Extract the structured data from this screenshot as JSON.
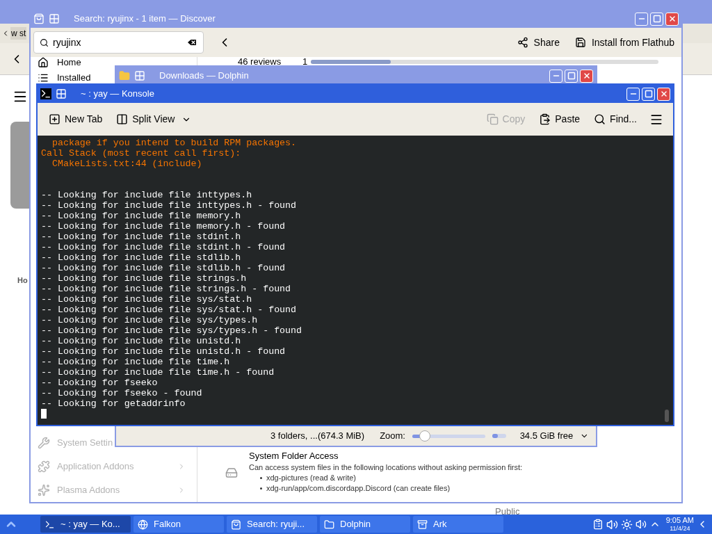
{
  "browser": {
    "tab": "w st",
    "heading_fragment": "Ho",
    "footer_fragment": "Public"
  },
  "discover": {
    "title": "Search: ryujinx - 1 item — Discover",
    "search": {
      "value": "ryujinx"
    },
    "actions": [
      {
        "kind": "share",
        "label": "Share"
      },
      {
        "kind": "install",
        "label": "Install from Flathub"
      }
    ],
    "sidebar_top": [
      {
        "kind": "home",
        "label": "Home"
      },
      {
        "kind": "installed",
        "label": "Installed"
      }
    ],
    "sidebar_bottom": [
      {
        "kind": "settings",
        "label": "System Settin",
        "disabled": true
      },
      {
        "kind": "addons",
        "label": "Application Addons",
        "disabled": true,
        "arrow": true
      },
      {
        "kind": "plasma",
        "label": "Plasma Addons",
        "disabled": true,
        "arrow": true
      }
    ],
    "reviews": {
      "label": "46 reviews",
      "star": "1",
      "level": 0.23
    },
    "permission": {
      "title": "System Folder Access",
      "description": "Can access system files in the following locations without asking permission first:",
      "items": [
        "xdg-pictures (read & write)",
        "xdg-run/app/com.discordapp.Discord (can create files)"
      ]
    }
  },
  "dolphin": {
    "title": "Downloads — Dolphin",
    "status": "3 folders, ...(674.3 MiB)",
    "zoom_label": "Zoom:",
    "zoom": {
      "level": 0.17
    },
    "disk": {
      "level": 0.4
    },
    "free_space": "34.5 GiB free"
  },
  "konsole": {
    "title": "~ : yay — Konsole",
    "toolbar": [
      {
        "kind": "newtab",
        "label": "New Tab",
        "disabled": false
      },
      {
        "kind": "split",
        "label": "Split View",
        "disabled": false
      },
      {
        "kind": "copy",
        "label": "Copy",
        "disabled": true
      },
      {
        "kind": "paste",
        "label": "Paste",
        "disabled": false
      },
      {
        "kind": "find",
        "label": "Find...",
        "disabled": false
      }
    ],
    "lines": [
      {
        "kind": "error",
        "text": "  package if you intend to build RPM packages."
      },
      {
        "kind": "error",
        "text": "Call Stack (most recent call first):"
      },
      {
        "kind": "error",
        "text": "  CMakeLists.txt:44 (include)"
      },
      {
        "kind": "blank"
      },
      {
        "kind": "blank"
      },
      {
        "kind": "normal",
        "text": "-- Looking for include file inttypes.h"
      },
      {
        "kind": "normal",
        "text": "-- Looking for include file inttypes.h - found"
      },
      {
        "kind": "normal",
        "text": "-- Looking for include file memory.h"
      },
      {
        "kind": "normal",
        "text": "-- Looking for include file memory.h - found"
      },
      {
        "kind": "normal",
        "text": "-- Looking for include file stdint.h"
      },
      {
        "kind": "normal",
        "text": "-- Looking for include file stdint.h - found"
      },
      {
        "kind": "normal",
        "text": "-- Looking for include file stdlib.h"
      },
      {
        "kind": "normal",
        "text": "-- Looking for include file stdlib.h - found"
      },
      {
        "kind": "normal",
        "text": "-- Looking for include file strings.h"
      },
      {
        "kind": "normal",
        "text": "-- Looking for include file strings.h - found"
      },
      {
        "kind": "normal",
        "text": "-- Looking for include file sys/stat.h"
      },
      {
        "kind": "normal",
        "text": "-- Looking for include file sys/stat.h - found"
      },
      {
        "kind": "normal",
        "text": "-- Looking for include file sys/types.h"
      },
      {
        "kind": "normal",
        "text": "-- Looking for include file sys/types.h - found"
      },
      {
        "kind": "normal",
        "text": "-- Looking for include file unistd.h"
      },
      {
        "kind": "normal",
        "text": "-- Looking for include file unistd.h - found"
      },
      {
        "kind": "normal",
        "text": "-- Looking for include file time.h"
      },
      {
        "kind": "normal",
        "text": "-- Looking for include file time.h - found"
      },
      {
        "kind": "normal",
        "text": "-- Looking for fseeko"
      },
      {
        "kind": "normal",
        "text": "-- Looking for fseeko - found"
      },
      {
        "kind": "normal",
        "text": "-- Looking for getaddrinfo"
      }
    ]
  },
  "taskbar": {
    "items": [
      {
        "kind": "terminal",
        "label": "~ : yay — Ko...",
        "selected": true
      },
      {
        "kind": "browser",
        "label": "Falkon",
        "selected": false
      },
      {
        "kind": "discover",
        "label": "Search: ryuji...",
        "selected": false
      },
      {
        "kind": "folder",
        "label": "Dolphin",
        "selected": false
      },
      {
        "kind": "archive",
        "label": "Ark",
        "selected": false
      }
    ],
    "time": "9:05 AM",
    "date": "11/4/24"
  }
}
